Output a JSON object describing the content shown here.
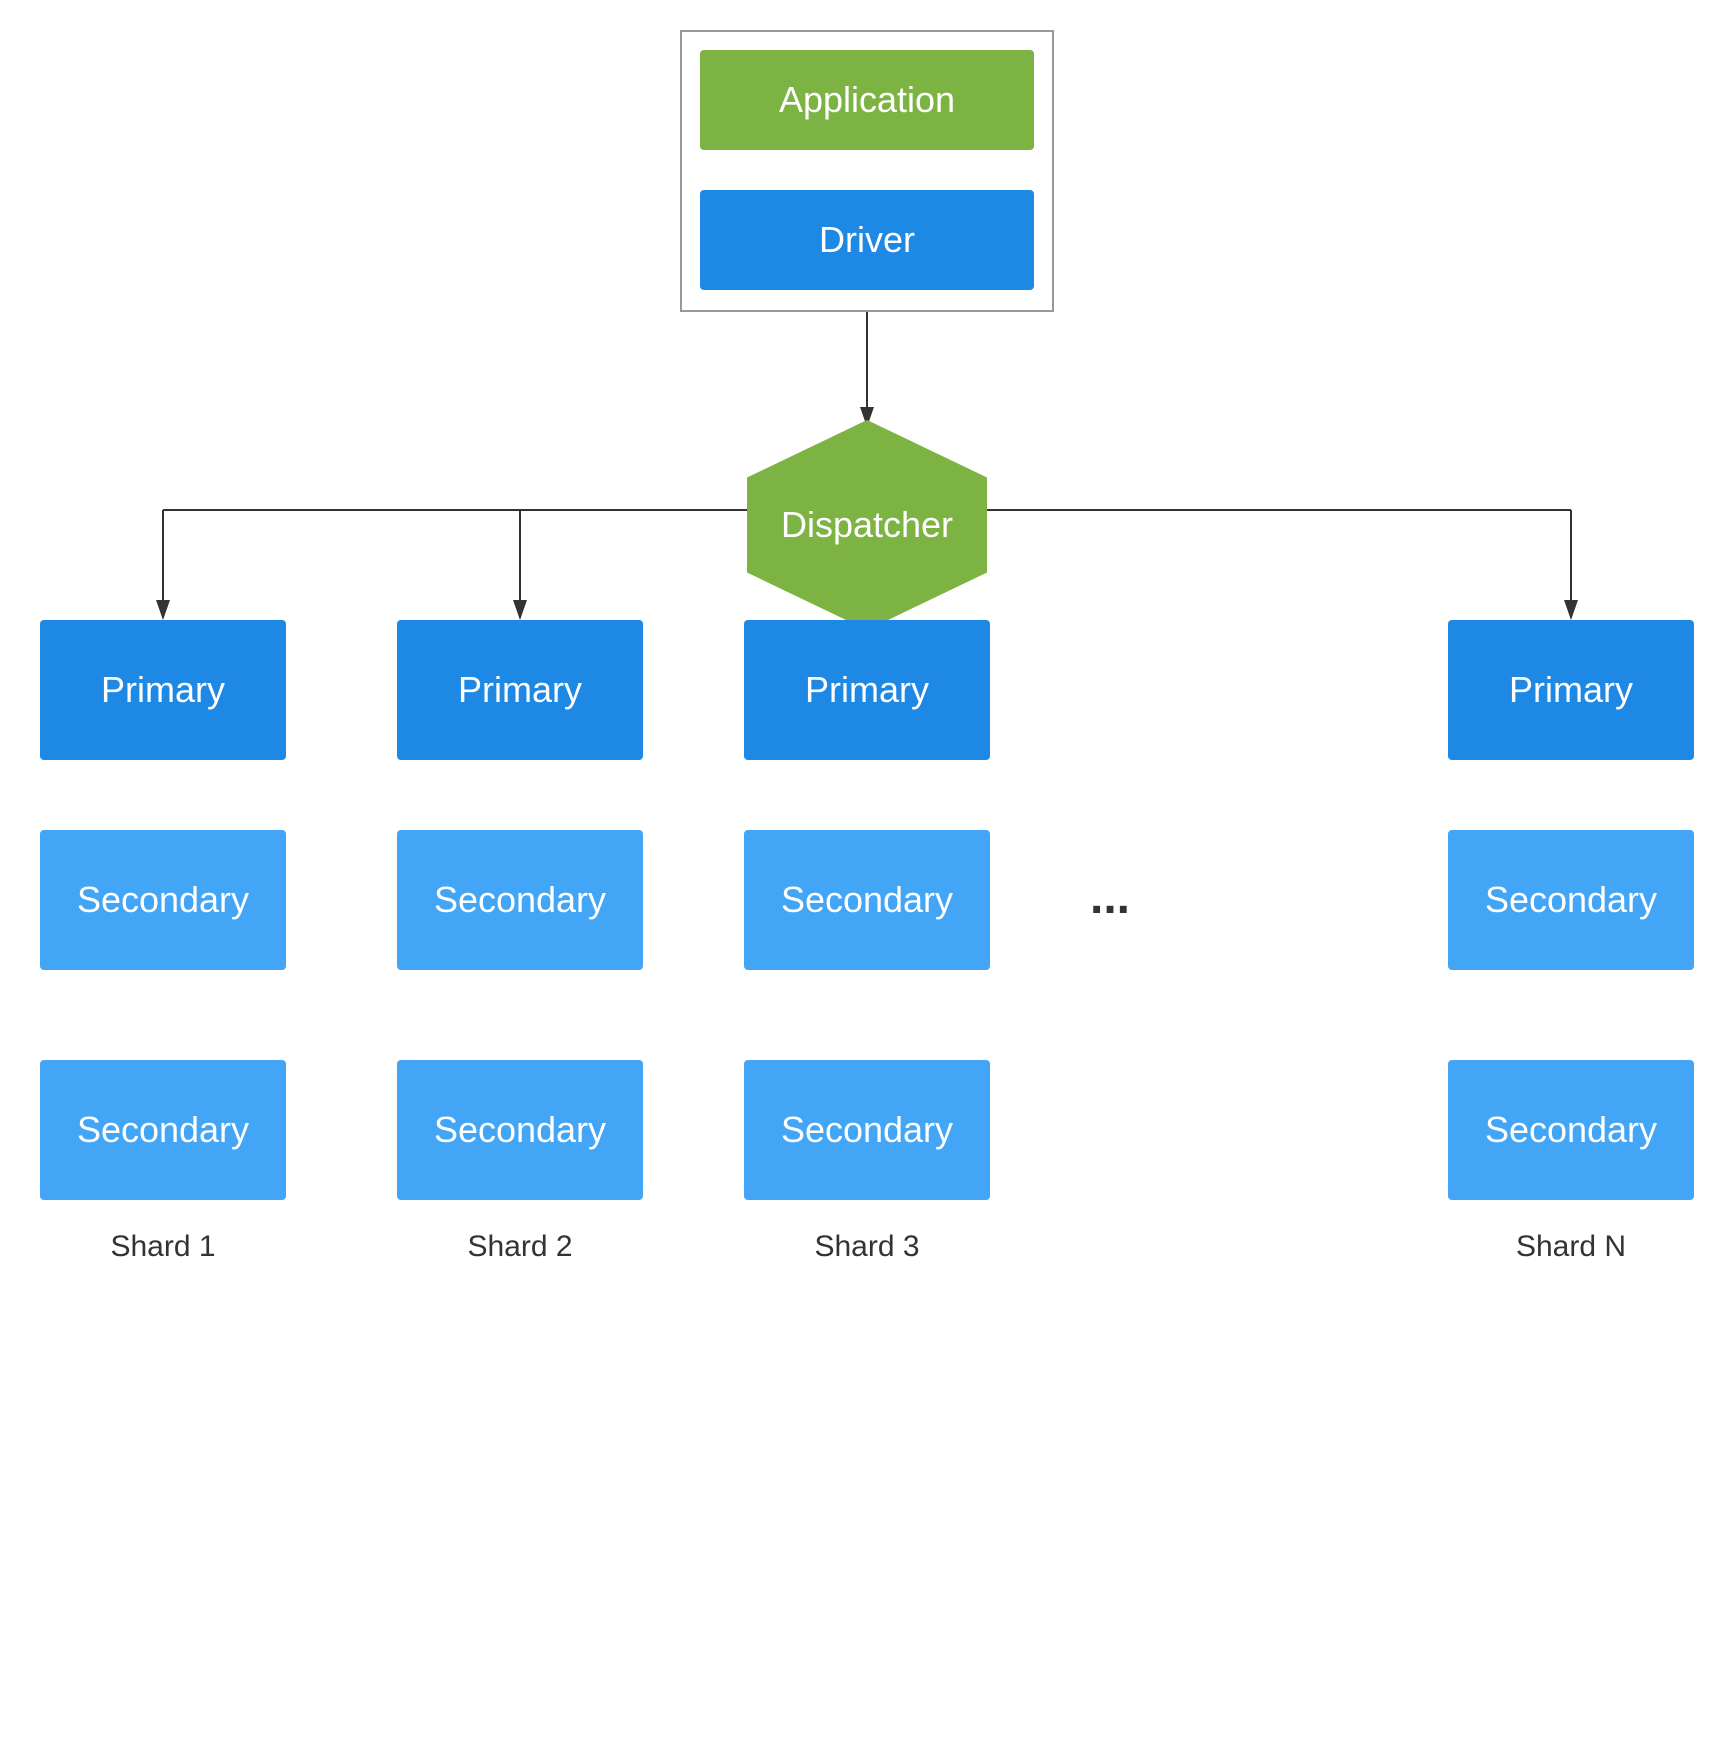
{
  "nodes": {
    "application": {
      "label": "Application"
    },
    "driver": {
      "label": "Driver"
    },
    "dispatcher": {
      "label": "Dispatcher"
    },
    "primary1": {
      "label": "Primary"
    },
    "primary2": {
      "label": "Primary"
    },
    "primary3": {
      "label": "Primary"
    },
    "primary4": {
      "label": "Primary"
    },
    "secondary1a": {
      "label": "Secondary"
    },
    "secondary2a": {
      "label": "Secondary"
    },
    "secondary3a": {
      "label": "Secondary"
    },
    "secondary4a": {
      "label": "Secondary"
    },
    "secondary1b": {
      "label": "Secondary"
    },
    "secondary2b": {
      "label": "Secondary"
    },
    "secondary3b": {
      "label": "Secondary"
    },
    "secondary4b": {
      "label": "Secondary"
    }
  },
  "shards": {
    "shard1": {
      "label": "Shard 1"
    },
    "shard2": {
      "label": "Shard 2"
    },
    "shard3": {
      "label": "Shard 3"
    },
    "shardN": {
      "label": "Shard N"
    }
  },
  "ellipsis": "...",
  "colors": {
    "green": "#7cb342",
    "blue_dark": "#1e88e5",
    "blue_light": "#42a5f5",
    "border": "#9e9e9e",
    "line": "#333333"
  }
}
